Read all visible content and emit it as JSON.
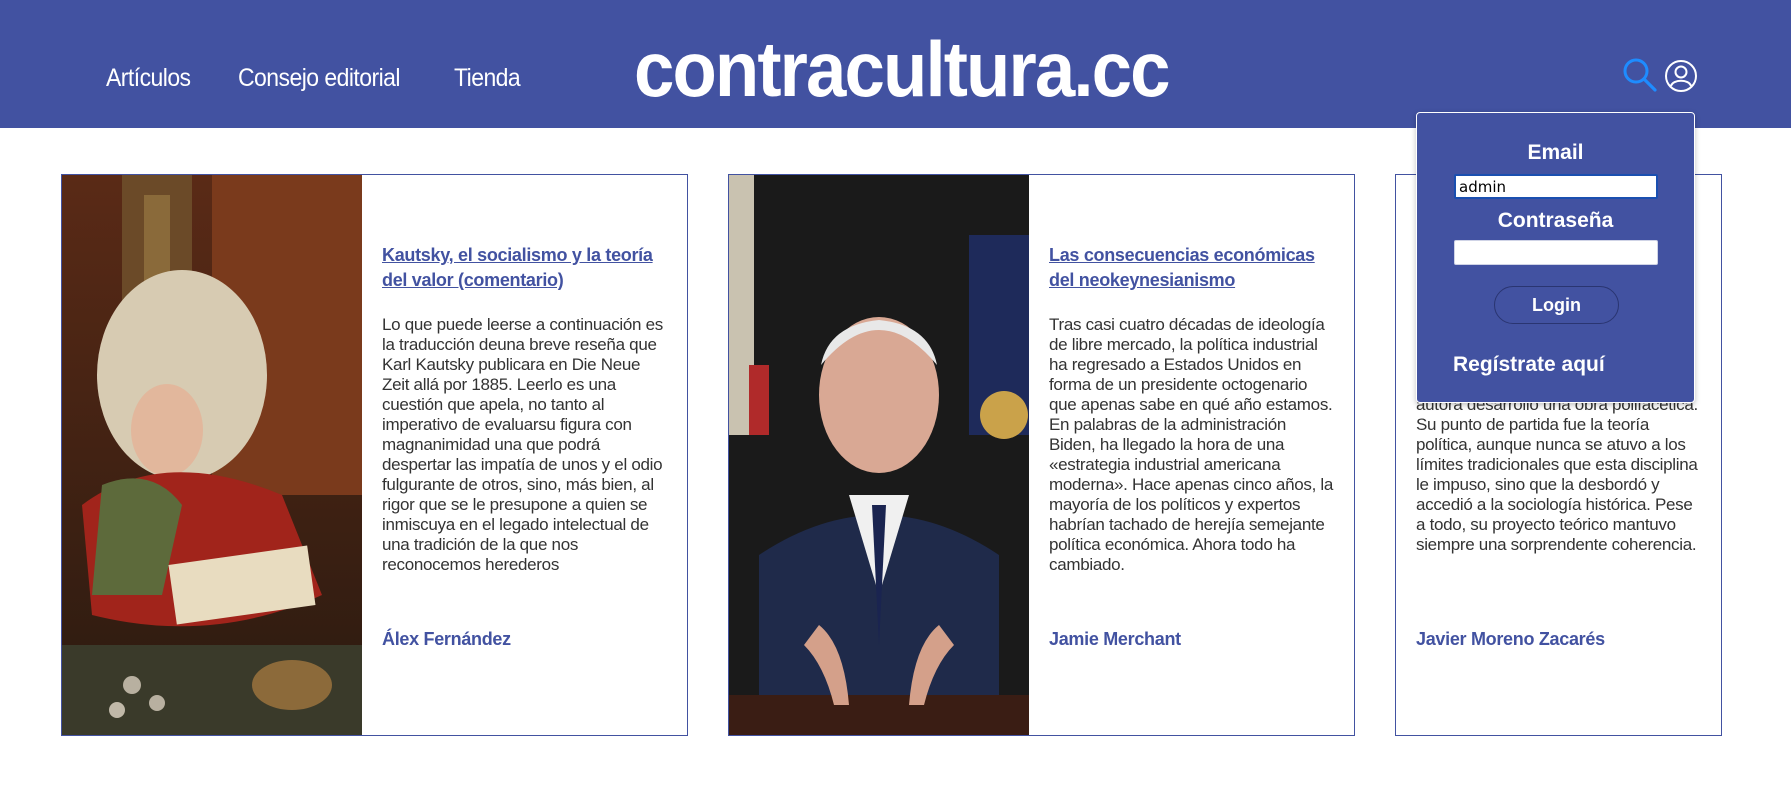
{
  "site": {
    "logo": "contracultura.cc",
    "nav": [
      "Artículos",
      "Consejo editorial",
      "Tienda"
    ],
    "brand_color": "#4252a1",
    "icons": [
      "search-icon",
      "user-icon"
    ]
  },
  "articles": [
    {
      "title": "Kautsky, el socialismo y la teoría del valor (comentario)",
      "excerpt": "Lo que puede leerse a continuación es la traducción deuna breve reseña que Karl Kautsky publicara en Die Neue Zeit allá por 1885. Leerlo es una cuestión que apela, no tanto al imperativo de evaluarsu figura con magnanimidad una que podrá despertar las impatía de unos y el odio fulgurante de otros, sino, más bien, al rigor que se le presupone a quien se inmiscuya en el legado intelectual de una tradición de la que nos reconocemos herederos",
      "author": "Álex Fernández"
    },
    {
      "title": "Las consecuencias económicas del neokeynesianismo",
      "excerpt": "Tras casi cuatro décadas de ideología de libre mercado, la política industrial ha regresado a Estados Unidos en forma de un presidente octogenario que apenas sabe en qué año estamos. En palabras de la administración Biden, ha llegado la hora de una «estrategia industrial americana moderna». Hace apenas cinco años, la mayoría de los políticos y expertos habrían tachado de herejía semejante política económica. Ahora todo ha cambiado.",
      "author": "Jamie Merchant"
    },
    {
      "title": "",
      "excerpt": "autora desarrolló una obra polifacética. Su punto de partida fue la teoría política, aunque nunca se atuvo a los límites tradicionales que esta disciplina le impuso, sino que la desbordó y accedió a la sociología histórica. Pese a todo, su proyecto teórico mantuvo siempre una sorprendente coherencia.",
      "author": "Javier Moreno Zacarés"
    }
  ],
  "login": {
    "email_label": "Email",
    "email_value": "admin",
    "password_label": "Contraseña",
    "password_value": "",
    "login_button": "Login",
    "register_link": "Regístrate aquí"
  }
}
